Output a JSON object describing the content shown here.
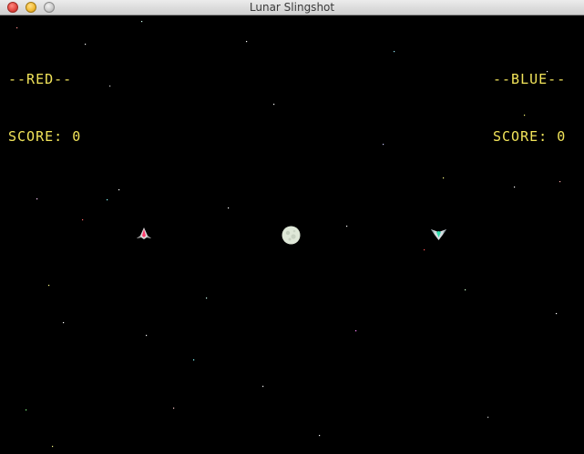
{
  "window": {
    "title": "Lunar Slingshot"
  },
  "players": {
    "red": {
      "name_label": "--RED--",
      "score_label": "SCORE: 0"
    },
    "blue": {
      "name_label": "--BLUE--",
      "score_label": "SCORE: 0"
    }
  },
  "colors": {
    "hud_text": "#f2e45a",
    "background": "#000000",
    "red_ship_accent": "#ff3b6b",
    "blue_ship_accent": "#2fe0b0",
    "moon": "#dfe8d8"
  },
  "icons": {
    "red_ship": "red-ship-icon",
    "blue_ship": "blue-ship-icon",
    "moon": "moon-icon"
  }
}
